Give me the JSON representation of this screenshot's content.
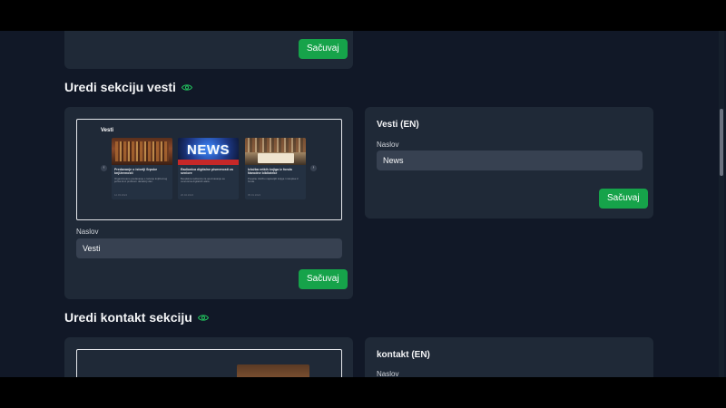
{
  "top_card": {
    "save_label": "Sačuvaj"
  },
  "news_section": {
    "title": "Uredi sekciju vesti",
    "preview": {
      "heading": "Vesti",
      "cards": [
        {
          "title": "Predavanje o istoriji Srpske književnosti",
          "text": "Organizovano predavanje o razvoju književnog jezika kroz prošlost i današnji dan.",
          "date": "12.03.2024"
        },
        {
          "title": "Radionica digitalne pismenosti za seniore",
          "text": "Besplatna radionica za upoznavanje sa osnovama digitalnih alata.",
          "date": "20.02.2024"
        },
        {
          "title": "Izložba retkih knjiga iz fonda Narodne biblioteke",
          "text": "Posetite izložbu najstarijih knjiga i rukopisa iz fonda.",
          "date": "05.01.2024"
        }
      ],
      "news_banner_text": "NEWS"
    },
    "field_label": "Naslov",
    "field_value": "Vesti",
    "save_label": "Sačuvaj",
    "en_card": {
      "heading": "Vesti (EN)",
      "field_label": "Naslov",
      "field_value": "News",
      "save_label": "Sačuvaj"
    }
  },
  "contact_section": {
    "title": "Uredi kontakt sekciju",
    "en_card": {
      "heading": "kontakt (EN)",
      "field_label": "Naslov"
    }
  },
  "colors": {
    "background": "#111827",
    "card": "#1f2937",
    "input": "#374151",
    "save_button": "#16a34a",
    "eye_icon": "#22c55e"
  }
}
